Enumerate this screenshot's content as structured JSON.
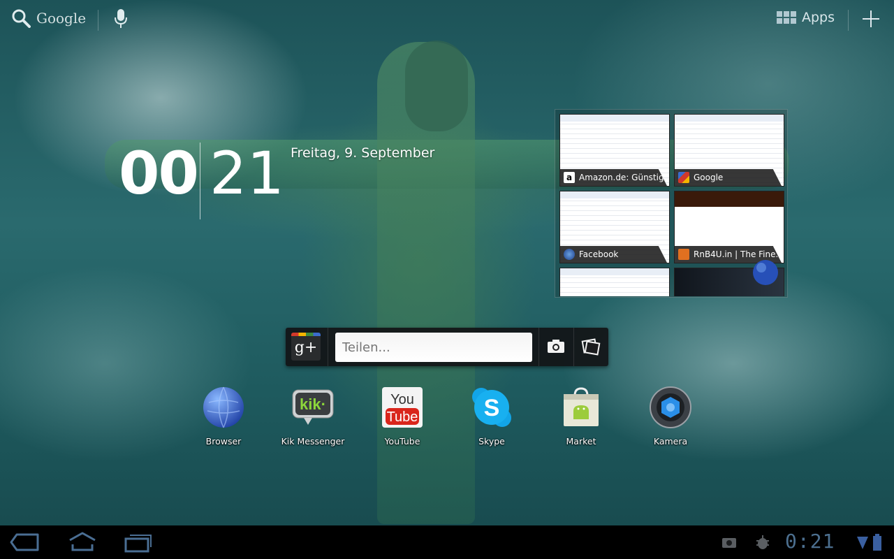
{
  "top_bar": {
    "search_label": "Google",
    "apps_label": "Apps"
  },
  "clock": {
    "hours": "00",
    "minutes": "21",
    "date": "Freitag, 9. September"
  },
  "bookmarks": [
    {
      "title": "Amazon.de: Günstig...",
      "favicon": "amazon-icon"
    },
    {
      "title": "Google",
      "favicon": "google-icon"
    },
    {
      "title": "Facebook",
      "favicon": "globe-icon"
    },
    {
      "title": "RnB4U.in | The Fine...",
      "favicon": "rnb4u-icon"
    },
    {
      "title": "",
      "favicon": ""
    },
    {
      "title": "",
      "favicon": ""
    }
  ],
  "share": {
    "placeholder": "Teilen...",
    "gplus_label": "g+"
  },
  "apps": [
    {
      "label": "Browser",
      "icon": "browser-icon"
    },
    {
      "label": "Kik Messenger",
      "icon": "kik-icon"
    },
    {
      "label": "YouTube",
      "icon": "youtube-icon"
    },
    {
      "label": "Skype",
      "icon": "skype-icon"
    },
    {
      "label": "Market",
      "icon": "market-icon"
    },
    {
      "label": "Kamera",
      "icon": "camera-icon"
    }
  ],
  "status_bar": {
    "time": "0:21",
    "accent": "#4c6f8f"
  }
}
